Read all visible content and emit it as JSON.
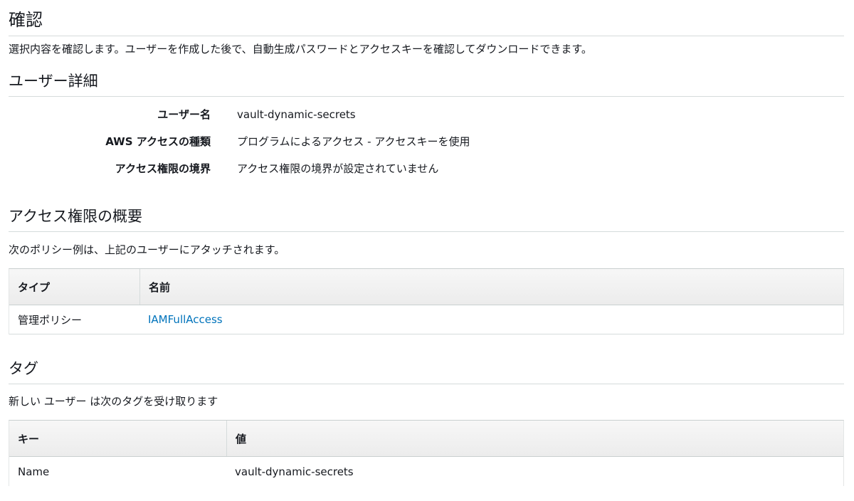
{
  "page": {
    "title": "確認",
    "intro": "選択内容を確認します。ユーザーを作成した後で、自動生成パスワードとアクセスキーを確認してダウンロードできます。"
  },
  "user_details": {
    "heading": "ユーザー詳細",
    "rows": [
      {
        "label": "ユーザー名",
        "value": "vault-dynamic-secrets"
      },
      {
        "label": "AWS アクセスの種類",
        "value": "プログラムによるアクセス - アクセスキーを使用"
      },
      {
        "label": "アクセス権限の境界",
        "value": "アクセス権限の境界が設定されていません"
      }
    ]
  },
  "permissions_summary": {
    "heading": "アクセス権限の概要",
    "description": "次のポリシー例は、上記のユーザーにアタッチされます。",
    "columns": [
      "タイプ",
      "名前"
    ],
    "rows": [
      {
        "type": "管理ポリシー",
        "name": "IAMFullAccess"
      }
    ],
    "link_color": "#0073bb"
  },
  "tags": {
    "heading": "タグ",
    "description": "新しい ユーザー は次のタグを受け取ります",
    "columns": [
      "キー",
      "値"
    ],
    "rows": [
      {
        "key": "Name",
        "value": "vault-dynamic-secrets"
      }
    ]
  }
}
